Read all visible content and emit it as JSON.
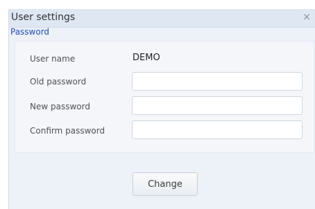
{
  "dialog": {
    "title": "User settings",
    "close_symbol": "×",
    "close_icon": "close-icon",
    "group_title": "Password",
    "colors": {
      "title_bar": "#dfe7f3",
      "dialog_background": "#edf1f8",
      "group_title": "#1f4cbd",
      "close": "#8e98a8"
    }
  },
  "form": {
    "user_name_label": "User name",
    "user_name_value": "DEMO",
    "old_password_label": "Old password",
    "old_password_value": "",
    "new_password_label": "New password",
    "new_password_value": "",
    "confirm_password_label": "Confirm password",
    "confirm_password_value": ""
  },
  "actions": {
    "change_label": "Change"
  }
}
